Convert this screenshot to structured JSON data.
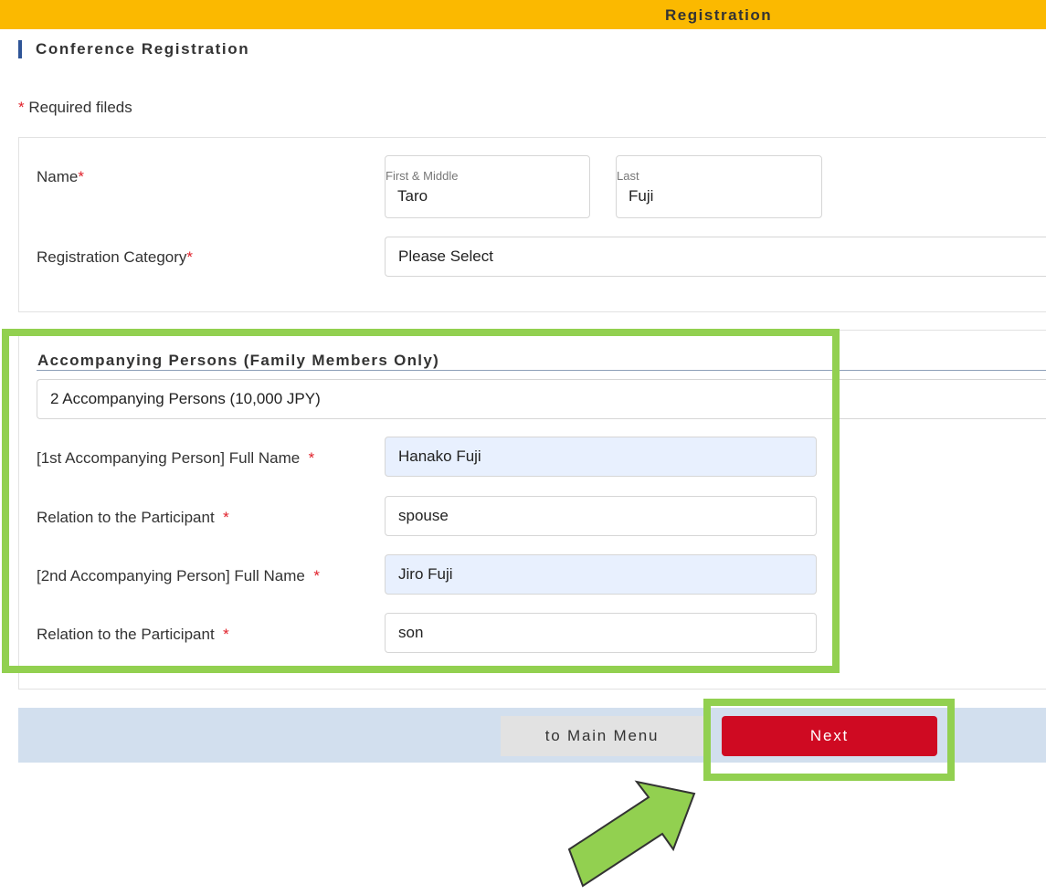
{
  "header": {
    "title": "Registration"
  },
  "section": {
    "title": "Conference Registration"
  },
  "required_note": {
    "star": "*",
    "text": " Required fileds"
  },
  "form": {
    "name": {
      "label": "Name",
      "required_mark": "*",
      "first": {
        "caption": "First & Middle",
        "value": "Taro"
      },
      "last": {
        "caption": "Last",
        "value": "Fuji"
      }
    },
    "category": {
      "label": "Registration Category",
      "required_mark": "*",
      "value": "Please Select"
    }
  },
  "accompanying": {
    "heading": "Accompanying Persons (Family Members Only)",
    "count_select": "2 Accompanying Persons (10,000 JPY)",
    "fields": [
      {
        "label": "[1st Accompanying Person] Full Name",
        "required_mark": "*",
        "value": "Hanako Fuji",
        "autofilled": true
      },
      {
        "label": "Relation to the Participant",
        "required_mark": "*",
        "value": "spouse",
        "autofilled": false
      },
      {
        "label": "[2nd Accompanying Person] Full Name",
        "required_mark": "*",
        "value": "Jiro Fuji",
        "autofilled": true
      },
      {
        "label": "Relation to the Participant",
        "required_mark": "*",
        "value": "son",
        "autofilled": false
      }
    ]
  },
  "footer": {
    "main_menu_label": "to Main Menu",
    "next_label": "Next"
  },
  "colors": {
    "header_bg": "#fbb900",
    "accent_bar": "#2f5597",
    "required": "#e0202a",
    "next_button": "#cf0a22",
    "footer_bg": "#d2dfee",
    "highlight": "#92d050",
    "autofill_bg": "#e8f0fe"
  }
}
